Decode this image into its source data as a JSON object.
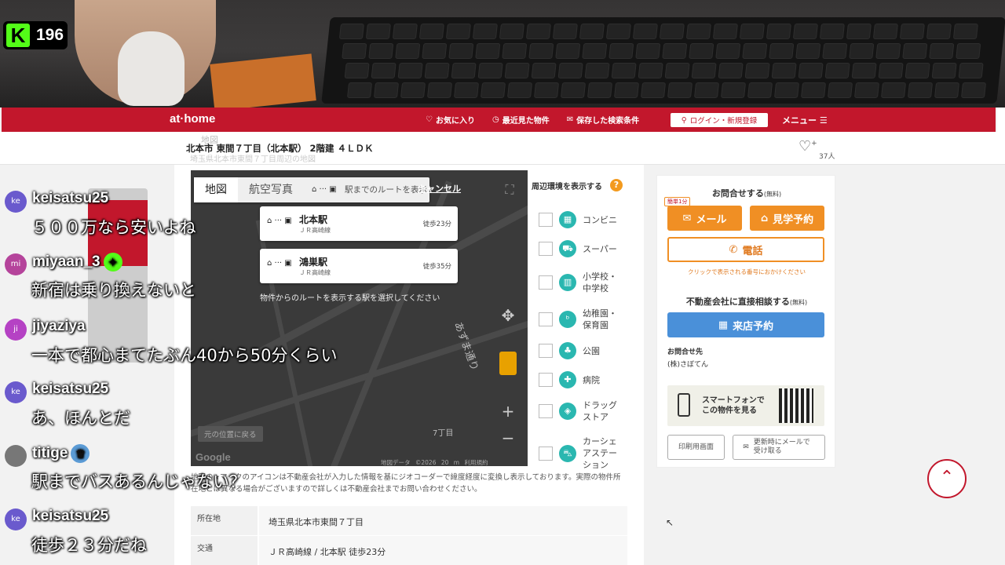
{
  "overlay": {
    "viewer_count": "196",
    "platform_logo": "K"
  },
  "header": {
    "logo": "at·home",
    "nav": [
      {
        "icon": "heart-icon",
        "label": "お気に入り"
      },
      {
        "icon": "clock-icon",
        "label": "最近見た物件"
      },
      {
        "icon": "mail-icon",
        "label": "保存した検索条件"
      }
    ],
    "login": "ログイン・新規登録",
    "menu": "メニュー"
  },
  "title_row": {
    "small": "地図",
    "title": "北本市 東間７丁目（北本駅） 2階建 ４ＬＤＫ",
    "sub": "埼玉県北本市東間７丁目周辺の地図",
    "fav_count": "37人"
  },
  "map": {
    "tabs": [
      "地図",
      "航空写真"
    ],
    "route_hint": "駅までのルートを表示",
    "cancel": "キャンセル",
    "stations": [
      {
        "name": "北本駅",
        "line": "ＪＲ高崎線",
        "walk": "徒歩23分"
      },
      {
        "name": "鴻巣駅",
        "line": "ＪＲ高崎線",
        "walk": "徒歩35分"
      }
    ],
    "note": "物件からのルートを表示する駅を選択してください",
    "street": "あずま通り",
    "chome": "7丁目",
    "back_to_current": "元の位置に戻る",
    "google": "Google",
    "attribution": "地図データ ©2026 20 m 利用規約"
  },
  "poi": {
    "header": "周辺環境を表示する",
    "help": "?",
    "items": [
      {
        "icon": "convenience-store-icon",
        "label": "コンビニ"
      },
      {
        "icon": "cart-icon",
        "label": "スーパー"
      },
      {
        "icon": "school-icon",
        "label": "小学校・中学校"
      },
      {
        "icon": "kindergarten-icon",
        "label": "幼稚園・保育園"
      },
      {
        "icon": "park-icon",
        "label": "公園"
      },
      {
        "icon": "hospital-icon",
        "label": "病院"
      },
      {
        "icon": "drugstore-icon",
        "label": "ドラッグストア"
      },
      {
        "icon": "car-icon",
        "label": "カーシェアステーション"
      }
    ]
  },
  "map_notice": "地図の★マークのアイコンは不動産会社が入力した情報を基にジオコーダーで緯度経度に変換し表示しております。実際の物件所在地とは異なる場合がございますので詳しくは不動産会社までお問い合わせください。",
  "info": [
    {
      "key": "所在地",
      "value": "埼玉県北本市東間７丁目"
    },
    {
      "key": "交通",
      "value": "ＪＲ高崎線 / 北本駅 徒歩23分"
    }
  ],
  "contact": {
    "heading": "お問合せする",
    "heading_note": "(無料)",
    "tag": "簡単1分",
    "mail": "メール",
    "visit": "見学予約",
    "phone": "電話",
    "phone_note": "クリックで表示される番号におかけください",
    "direct_heading": "不動産会社に直接相談する",
    "direct_note": "(無料)",
    "reserve": "来店予約",
    "contact_label": "お問合せ先",
    "company": "(株)さぼてん",
    "smartphone": "スマートフォンでこの物件を見る",
    "print": "印刷用画面",
    "notify": "更新時にメールで受け取る"
  },
  "chat": [
    {
      "user": "keisatsu25",
      "avatar": "ke",
      "color": "#6a5acd",
      "text": "５００万なら安いよね",
      "badge": ""
    },
    {
      "user": "miyaan_3",
      "avatar": "mi",
      "color": "#b5449b",
      "text": "新宿は乗り換えないと",
      "badge": "✦"
    },
    {
      "user": "jiyaziya",
      "avatar": "ji",
      "color": "#b542c4",
      "text": "一本で都心まてたぶん40から50分くらい",
      "badge": ""
    },
    {
      "user": "keisatsu25",
      "avatar": "ke",
      "color": "#6a5acd",
      "text": "あ、ほんとだ",
      "badge": ""
    },
    {
      "user": "titige",
      "avatar": "",
      "color": "#777777",
      "text": "駅までバスあるんじゃない？",
      "badge": "♛"
    },
    {
      "user": "keisatsu25",
      "avatar": "ke",
      "color": "#6a5acd",
      "text": "徒歩２３分だね",
      "badge": ""
    }
  ],
  "colors": {
    "brand": "#c2172c",
    "accent": "#f08f24",
    "blue": "#4a90d9",
    "kick": "#53fc18"
  }
}
